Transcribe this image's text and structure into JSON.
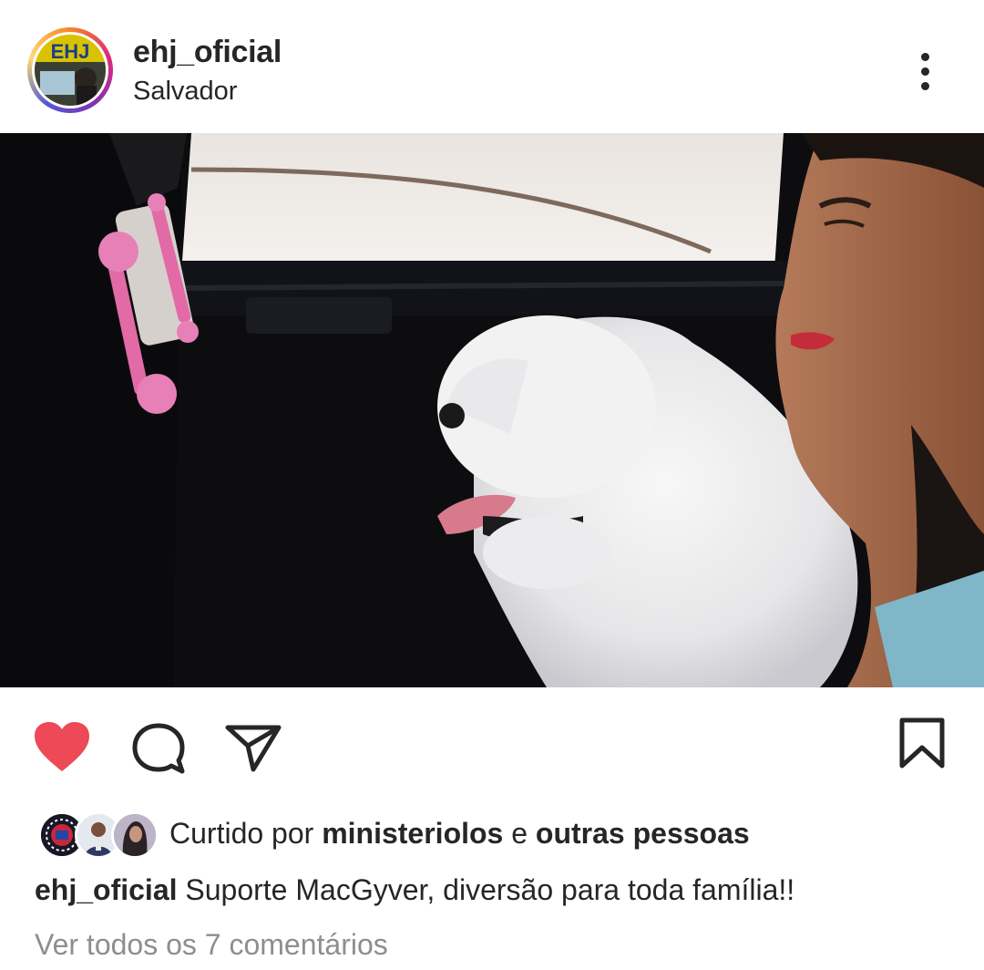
{
  "post": {
    "author": {
      "username": "ehj_oficial",
      "location": "Salvador",
      "avatar_logo_text": "EHJ"
    },
    "media": {
      "type": "video-frame"
    },
    "actions": {
      "liked": true,
      "like_color": "#ed4956",
      "icons": [
        "heart-icon",
        "comment-icon",
        "share-icon",
        "bookmark-icon"
      ]
    },
    "likes": {
      "prefix": "Curtido por",
      "user": "ministeriolos",
      "connector": "e",
      "others": "outras pessoas"
    },
    "caption": {
      "username": "ehj_oficial",
      "text": "Suporte MacGyver, diversão para toda família!!"
    },
    "comments_link": "Ver todos os 7 comentários"
  }
}
